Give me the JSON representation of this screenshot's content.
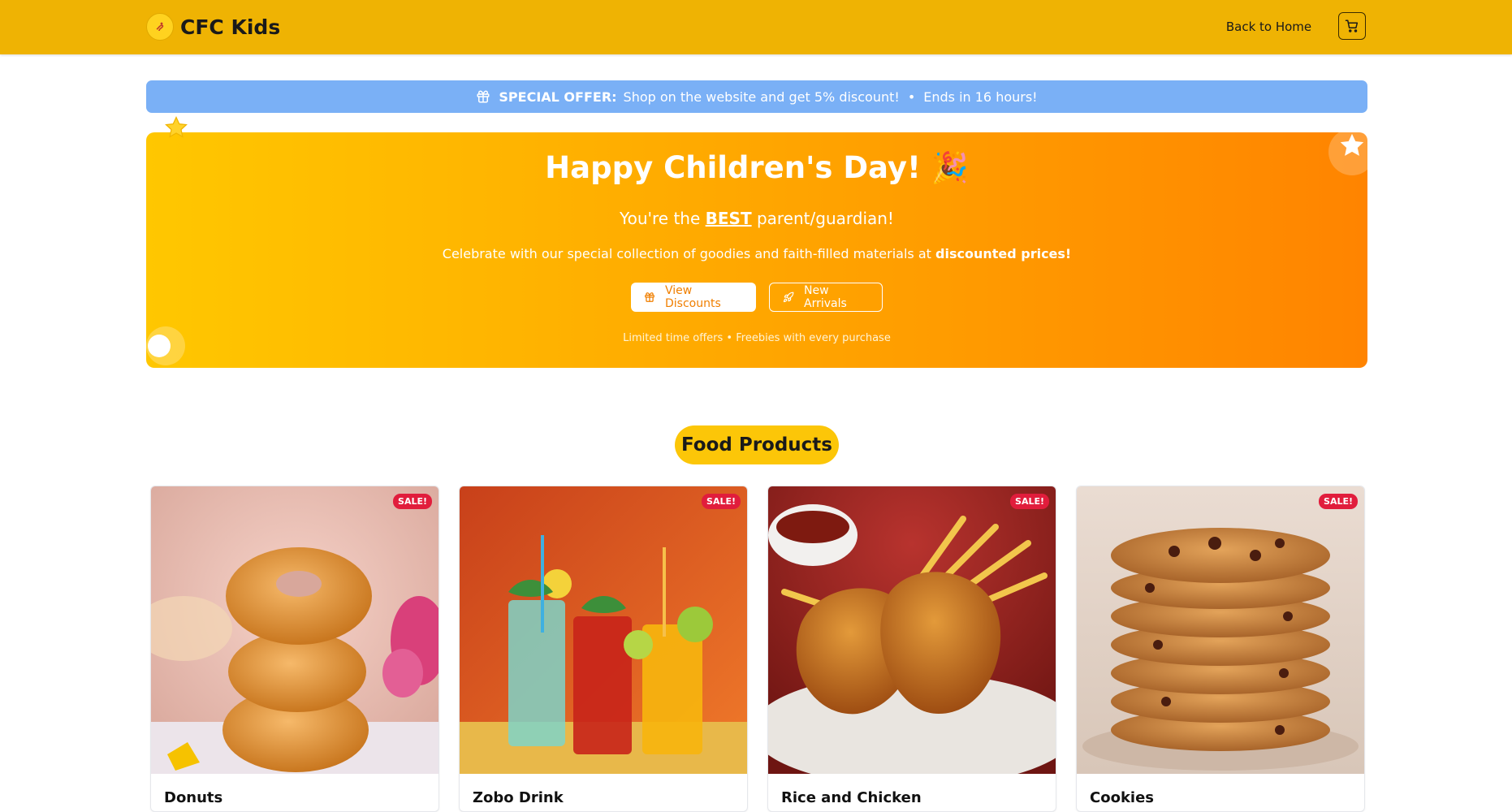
{
  "header": {
    "brand": "CFC Kids",
    "back_home": "Back to Home"
  },
  "offer": {
    "label": "SPECIAL OFFER:",
    "message": "Shop on the website and get 5% discount!",
    "separator": "•",
    "ends": "Ends in 16 hours!"
  },
  "hero": {
    "title": "Happy Children's Day! 🎉",
    "sub_prefix": "You're the ",
    "sub_best": "BEST",
    "sub_suffix": " parent/guardian!",
    "desc_prefix": "Celebrate with our special collection of goodies and faith-filled materials at ",
    "desc_bold": "discounted prices!",
    "btn_discounts": "View Discounts",
    "btn_arrivals": "New Arrivals",
    "note": "Limited time offers • Freebies with every purchase"
  },
  "section": {
    "title": "Food Products"
  },
  "products": [
    {
      "name": "Donuts",
      "badge": "SALE!"
    },
    {
      "name": "Zobo Drink",
      "badge": "SALE!"
    },
    {
      "name": "Rice and Chicken",
      "badge": "SALE!"
    },
    {
      "name": "Cookies",
      "badge": "SALE!"
    }
  ],
  "colors": {
    "header_bg": "#efb303",
    "offer_bg": "#7ab0f6",
    "hero_start": "#ffc700",
    "hero_end": "#ff8400",
    "pill_bg": "#fcc608",
    "sale_badge": "#e11d3c"
  },
  "icons": [
    "logo-icon",
    "cart-icon",
    "gift-icon",
    "rocket-icon",
    "star-icon"
  ]
}
